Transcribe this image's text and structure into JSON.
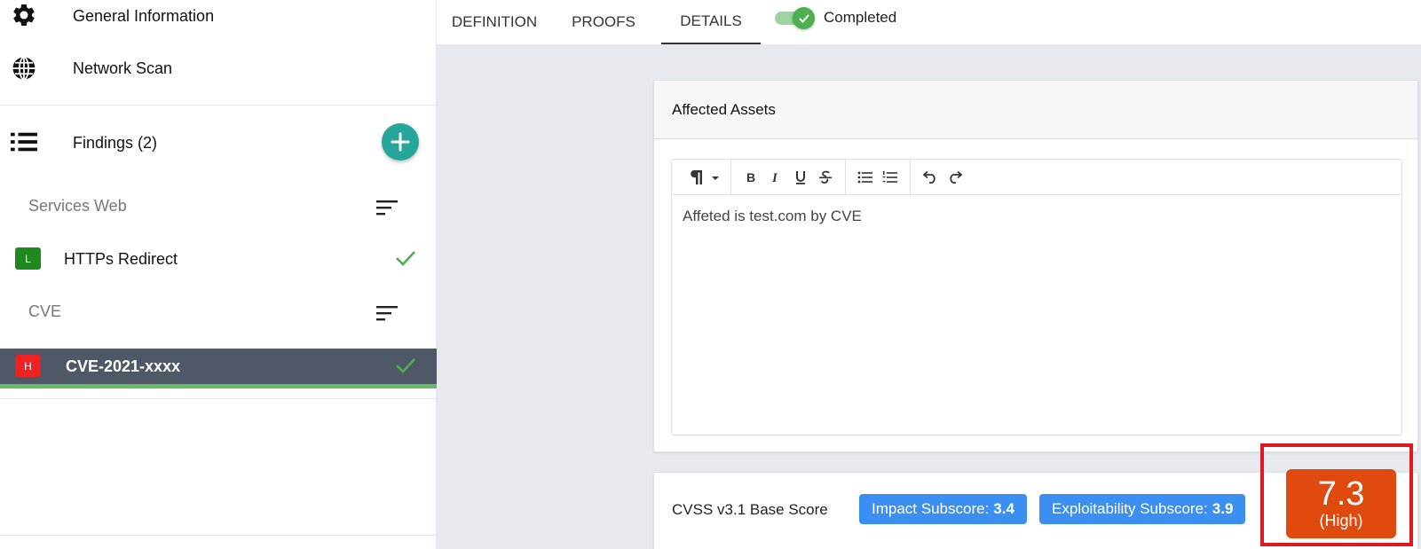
{
  "sidebar": {
    "general_label": "General Information",
    "network_label": "Network Scan",
    "findings_label": "Findings (2)",
    "categories": [
      {
        "label": "Services Web",
        "finding": {
          "severity": "L",
          "label": "HTTPs Redirect",
          "sev_color": "#1e8a1e"
        }
      },
      {
        "label": "CVE",
        "finding": {
          "severity": "H",
          "label": "CVE-2021-xxxx",
          "sev_color": "#ee2222"
        }
      }
    ]
  },
  "tabs": [
    {
      "label": "DEFINITION"
    },
    {
      "label": "PROOFS"
    },
    {
      "label": "DETAILS",
      "active": true
    }
  ],
  "toggle": {
    "label": "Completed",
    "on": true
  },
  "assets": {
    "title": "Affected Assets",
    "content": "Affeted is test.com by CVE"
  },
  "cvss": {
    "label": "CVSS v3.1 Base Score",
    "impact_label": "Impact Subscore:",
    "impact_value": "3.4",
    "exploit_label": "Exploitability Subscore:",
    "exploit_value": "3.9",
    "score": "7.3",
    "severity": "(High)"
  },
  "colors": {
    "accent_teal": "#26a69a",
    "chip_blue": "#3b8ff1",
    "score_high": "#e04a0f",
    "highlight_red": "#e0191e",
    "check_green": "#4caf50"
  }
}
